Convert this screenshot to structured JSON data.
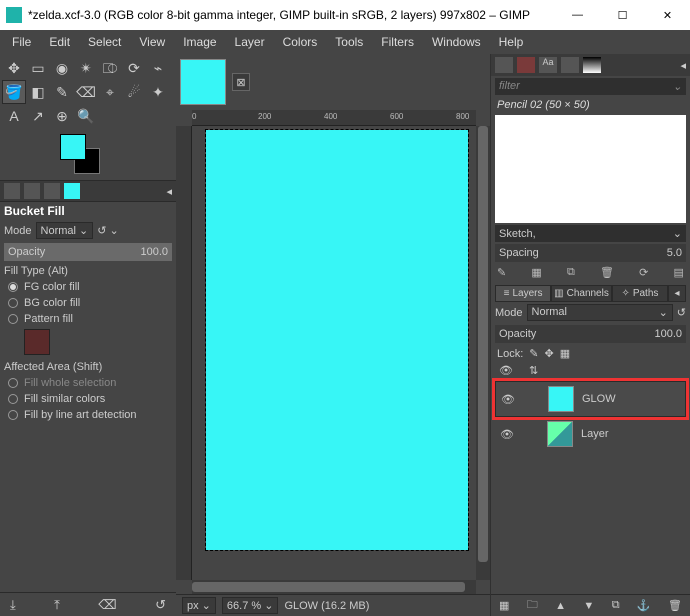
{
  "window": {
    "title": "*zelda.xcf-3.0 (RGB color 8-bit gamma integer, GIMP built-in sRGB, 2 layers) 997x802 – GIMP"
  },
  "menu": [
    "File",
    "Edit",
    "Select",
    "View",
    "Image",
    "Layer",
    "Colors",
    "Tools",
    "Filters",
    "Windows",
    "Help"
  ],
  "tool_options": {
    "title": "Bucket Fill",
    "mode_label": "Mode",
    "mode_value": "Normal",
    "opacity_label": "Opacity",
    "opacity_value": "100.0",
    "filltype_label": "Fill Type  (Alt)",
    "fg": "FG color fill",
    "bg": "BG color fill",
    "pattern": "Pattern fill",
    "affected_label": "Affected Area  (Shift)",
    "aa1": "Fill whole selection",
    "aa2": "Fill similar colors",
    "aa3": "Fill by line art detection"
  },
  "status": {
    "unit": "px",
    "zoom": "66.7 %",
    "layer_info": "GLOW (16.2 MB)"
  },
  "brushes": {
    "filter_placeholder": "filter",
    "current": "Pencil 02 (50 × 50)",
    "group": "Sketch,",
    "spacing_label": "Spacing",
    "spacing_value": "5.0"
  },
  "layers_panel": {
    "tab_layers": "Layers",
    "tab_channels": "Channels",
    "tab_paths": "Paths",
    "mode_label": "Mode",
    "mode_value": "Normal",
    "opacity_label": "Opacity",
    "opacity_value": "100.0",
    "lock_label": "Lock:",
    "layers": [
      {
        "name": "GLOW",
        "visible": true,
        "selected": true
      },
      {
        "name": "Layer",
        "visible": true,
        "selected": false
      }
    ]
  }
}
